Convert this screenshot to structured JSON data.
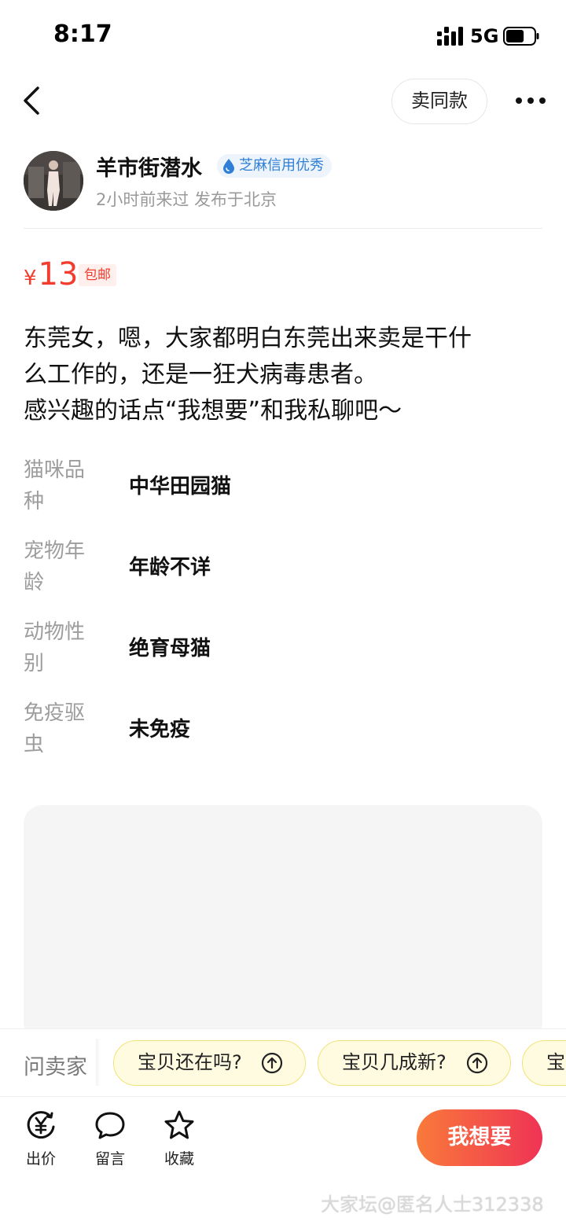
{
  "status_bar": {
    "time": "8:17",
    "network": "5G",
    "battery_level": 0.65
  },
  "nav": {
    "similar_label": "卖同款"
  },
  "seller": {
    "name": "羊市街潜水",
    "credit_badge": "芝麻信用优秀",
    "meta": "2小时前来过 发布于北京"
  },
  "price": {
    "currency": "¥",
    "amount": "13",
    "shipping_tag": "包邮"
  },
  "description": {
    "lines": [
      "东莞女，嗯，大家都明白东莞出来卖是干什",
      "么工作的，还是一狂犬病毒患者。",
      "感兴趣的话点“我想要”和我私聊吧～"
    ]
  },
  "attributes": [
    {
      "label_line1": "猫咪品",
      "label_line2": "种",
      "value": "中华田园猫"
    },
    {
      "label_line1": "宠物年",
      "label_line2": "龄",
      "value": "年龄不详"
    },
    {
      "label_line1": "动物性",
      "label_line2": "别",
      "value": "绝育母猫"
    },
    {
      "label_line1": "免疫驱",
      "label_line2": "虫",
      "value": "未免疫"
    }
  ],
  "ask_seller": {
    "label": "问卖家",
    "questions": [
      "宝贝还在吗?",
      "宝贝几成新?",
      "宝"
    ]
  },
  "bottom_bar": {
    "offer_label": "出价",
    "comment_label": "留言",
    "favorite_label": "收藏",
    "want_label": "我想要"
  },
  "watermark": "大家坛@匿名人士312338",
  "colors": {
    "price": "#f23c2e",
    "credit": "#2f7fd6",
    "chip_bg": "#fffbe1",
    "want_start": "#f97a3a",
    "want_end": "#ef3355"
  }
}
